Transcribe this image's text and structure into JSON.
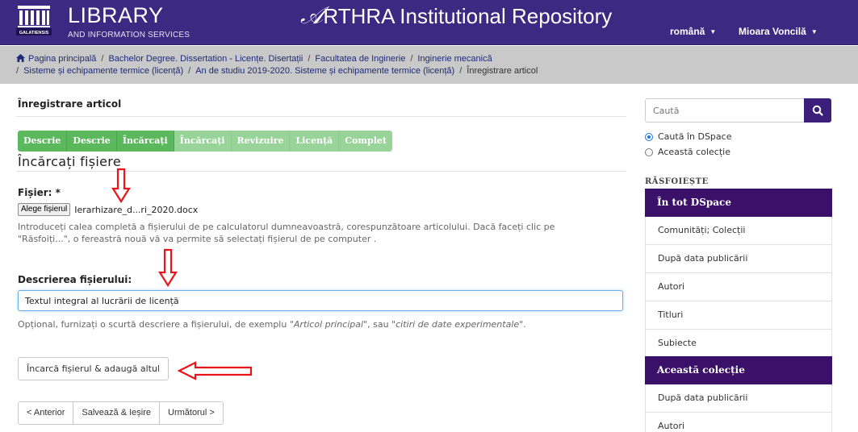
{
  "header": {
    "logo_main": "LIBRARY",
    "logo_sub": "AND INFORMATION SERVICES",
    "logo_badge": "GALATIENSIS",
    "site_title_rest": "RTHRA Institutional Repository",
    "language": "română",
    "user": "Mioara Voncilă"
  },
  "breadcrumb": {
    "items": [
      "Pagina principală",
      "Bachelor Degree. Dissertation - Licențe. Disertații",
      "Facultatea de Inginerie",
      "Inginerie mecanică",
      "Sisteme și echipamente termice (licență)",
      "An de studiu 2019-2020. Sisteme și echipamente termice (licență)",
      "Înregistrare articol"
    ]
  },
  "main": {
    "page_title": "Înregistrare articol",
    "steps": [
      {
        "label": "Descrie",
        "state": "done"
      },
      {
        "label": "Descrie",
        "state": "done"
      },
      {
        "label": "Încărcați",
        "state": "current"
      },
      {
        "label": "Încărcați",
        "state": "todo"
      },
      {
        "label": "Revizuire",
        "state": "todo"
      },
      {
        "label": "Licență",
        "state": "todo"
      },
      {
        "label": "Complet",
        "state": "todo"
      }
    ],
    "section_title": "Încărcați fișiere",
    "file_label": "Fișier: *",
    "file_button": "Alege fișierul",
    "file_name": "Ierarhizare_d...ri_2020.docx",
    "file_help_1": "Introduceți calea completă a fișierului de pe calculatorul dumneavoastră, corespunzătoare articolului. Dacă faceți clic pe",
    "file_help_2": "\"Răsfoiți...\", o fereastră nouă vă va permite să selectați fișierul de pe computer .",
    "desc_label": "Descrierea fișierului:",
    "desc_value": "Textul integral al lucrării de licență",
    "desc_help_prefix": "Opțional, furnizați o scurtă descriere a fișierului, de exemplu \"",
    "desc_help_ex1": "Articol principal",
    "desc_help_mid": "\", sau \"",
    "desc_help_ex2": "citiri de date experimentale",
    "desc_help_suffix": "\".",
    "upload_button": "Încarcă fișierul & adaugă altul",
    "prev_button": "< Anterior",
    "save_button": "Salvează & Ieșire",
    "next_button": "Următorul >"
  },
  "sidebar": {
    "search_placeholder": "Caută",
    "scope_options": [
      "Caută în DSpace",
      "Această colecție"
    ],
    "scope_selected": "Caută în DSpace",
    "browse_heading": "RĂSFOIEȘTE",
    "all_heading": "În tot DSpace",
    "all_items": [
      "Comunități; Colecții",
      "După data publicării",
      "Autori",
      "Titluri",
      "Subiecte"
    ],
    "collection_heading": "Această colecție",
    "collection_items": [
      "După data publicării",
      "Autori"
    ]
  },
  "colors": {
    "header_bg": "#3b2a82",
    "breadcrumb_bg": "#c9c9c9",
    "step_active": "#5cb85c",
    "step_inactive": "#98d498",
    "sidebar_head": "#3b1069",
    "annotation_arrow": "#e8141a"
  },
  "icons": [
    "home-icon",
    "search-icon",
    "caret-down-icon",
    "library-logo"
  ]
}
